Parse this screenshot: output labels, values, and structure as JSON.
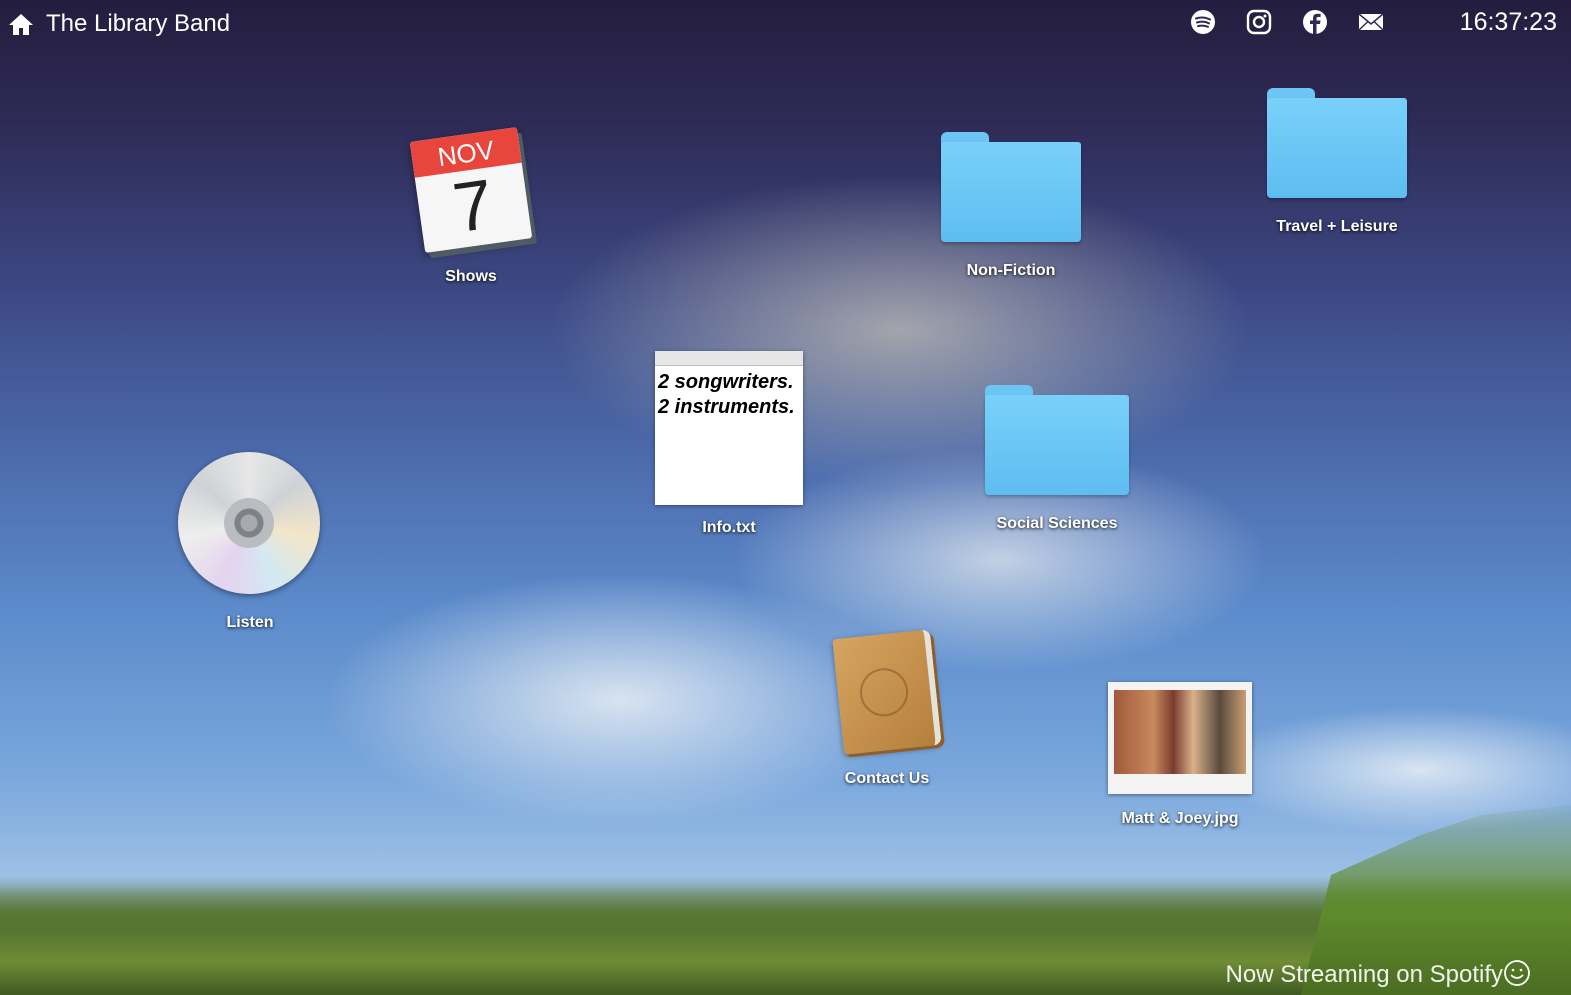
{
  "topbar": {
    "title": "The Library Band",
    "icons": [
      "spotify-icon",
      "instagram-icon",
      "facebook-icon",
      "mail-icon"
    ],
    "clock": "16:37:23"
  },
  "desktop": {
    "shows": {
      "label": "Shows",
      "month": "NOV",
      "day": "7"
    },
    "listen": {
      "label": "Listen"
    },
    "info": {
      "label": "Info.txt",
      "line1": "2 songwriters.",
      "line2": "2 instruments."
    },
    "non_fiction": {
      "label": "Non-Fiction"
    },
    "travel": {
      "label": "Travel + Leisure"
    },
    "social": {
      "label": "Social Sciences"
    },
    "contact": {
      "label": "Contact Us"
    },
    "photo": {
      "label": "Matt & Joey.jpg"
    }
  },
  "footer": {
    "text": "Now Streaming on Spotify"
  },
  "colors": {
    "folder": "#79d0fa",
    "calendar_red": "#e8453c"
  }
}
